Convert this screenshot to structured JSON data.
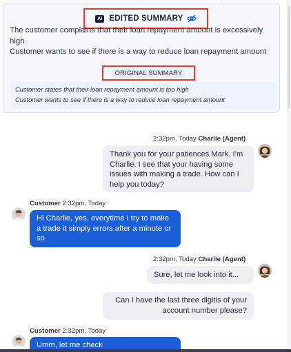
{
  "summary": {
    "edited_header": "EDITED SUMMARY",
    "ai_badge": "AI",
    "edited_lines": [
      "The customer complains that their loan repayment amount is excessively high.",
      "Customer wants to see if there is a way to reduce loan repayment amount"
    ],
    "original_header": "ORIGINAL SUMMARY",
    "original_lines": [
      "Customer states that their loan repayment amount is  too high",
      "Customer wants to see if there is a way to reduce loan repayment amount"
    ]
  },
  "chat": {
    "messages": [
      {
        "role": "agent",
        "time": "2:32pm, Today",
        "name": "Charlie (Agent)",
        "text": "Thank you for your patiences Mark. I’m Charlie. I see that your having some issues with making a trade. How can I help you today?"
      },
      {
        "role": "customer",
        "time": "2:32pm, Today",
        "name": "Customer",
        "text": "Hi Charlie, yes, everytime I try to make a trade it simply errors after a minute or so"
      },
      {
        "role": "agent",
        "time": "2:32pm, Today",
        "name": "Charlie (Agent)",
        "text": "Sure, let me look into it..."
      },
      {
        "role": "agent",
        "time": "",
        "name": "",
        "text": "Can I have the last three digitis of your account number please?"
      },
      {
        "role": "customer",
        "time": "2:32pm, Today",
        "name": "Customer",
        "text": "Umm, let me check"
      }
    ]
  },
  "colors": {
    "accent": "#1a5fd6",
    "highlight": "#e53935",
    "agent_bubble": "#eceef2"
  },
  "icons": {
    "eye_off": "eye-off-icon",
    "ai": "ai-badge-icon"
  }
}
